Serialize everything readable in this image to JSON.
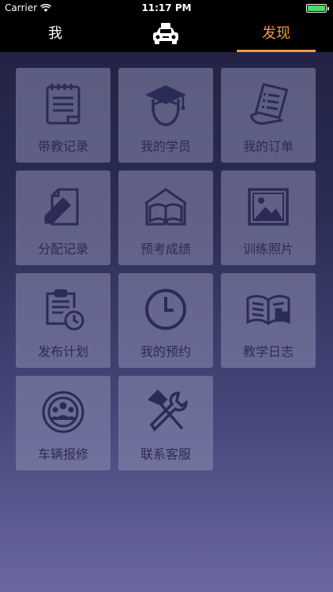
{
  "status_bar": {
    "carrier": "Carrier",
    "time": "11:17 PM",
    "battery_level": 1.0
  },
  "navbar": {
    "tab_me": "我",
    "tab_discover": "发现",
    "active_tab": "discover",
    "logo_icon": "taxi-icon",
    "accent_color": "#f39a3c"
  },
  "grid": {
    "items": [
      {
        "label": "带教记录",
        "icon": "notebook-icon"
      },
      {
        "label": "我的学员",
        "icon": "graduate-icon"
      },
      {
        "label": "我的订单",
        "icon": "receipt-icon"
      },
      {
        "label": "分配记录",
        "icon": "edit-document-icon"
      },
      {
        "label": "预考成绩",
        "icon": "open-book-icon"
      },
      {
        "label": "训练照片",
        "icon": "photo-icon"
      },
      {
        "label": "发布计划",
        "icon": "clipboard-clock-icon"
      },
      {
        "label": "我的预约",
        "icon": "clock-icon"
      },
      {
        "label": "教学日志",
        "icon": "book-pointer-icon"
      },
      {
        "label": "车辆报修",
        "icon": "steering-wheel-icon"
      },
      {
        "label": "联系客服",
        "icon": "tools-icon"
      }
    ]
  }
}
